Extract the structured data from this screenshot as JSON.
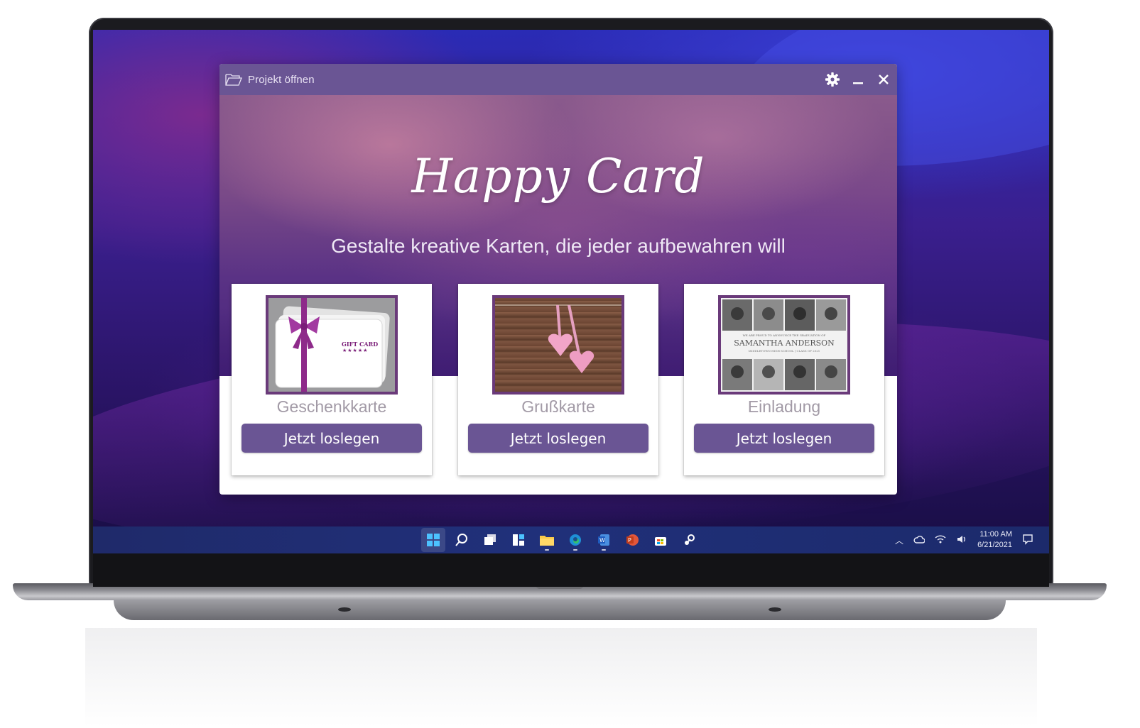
{
  "window": {
    "title": "Projekt öffnen",
    "app_title": "Happy Card",
    "subtitle": "Gestalte kreative Karten, die jeder aufbewahren will"
  },
  "cards": [
    {
      "label": "Geschenkkarte",
      "button": "Jetzt loslegen",
      "thumb_text": "GIFT CARD",
      "thumb_stars": "★★★★★"
    },
    {
      "label": "Grußkarte",
      "button": "Jetzt loslegen"
    },
    {
      "label": "Einladung",
      "button": "Jetzt loslegen",
      "thumb_heading": "WE ARE PROUD TO ANNOUNCE THE GRADUATION OF",
      "thumb_name": "SAMANTHA ANDERSON",
      "thumb_sub": "MIDDLETOWN HIGH SCHOOL | CLASS OF 2021"
    }
  ],
  "taskbar": {
    "icons": [
      "start-icon",
      "search-icon",
      "task-view-icon",
      "widgets-icon",
      "file-explorer-icon",
      "edge-icon",
      "word-icon",
      "powerpoint-icon",
      "store-icon",
      "steam-icon"
    ],
    "tray_icons": [
      "chevron-up-icon",
      "cloud-icon",
      "wifi-icon",
      "volume-icon"
    ],
    "time": "11:00 AM",
    "date": "6/21/2021"
  },
  "colors": {
    "accent": "#6a5594",
    "card_border": "#6a3a7a",
    "label_gray": "#a29aa6"
  }
}
